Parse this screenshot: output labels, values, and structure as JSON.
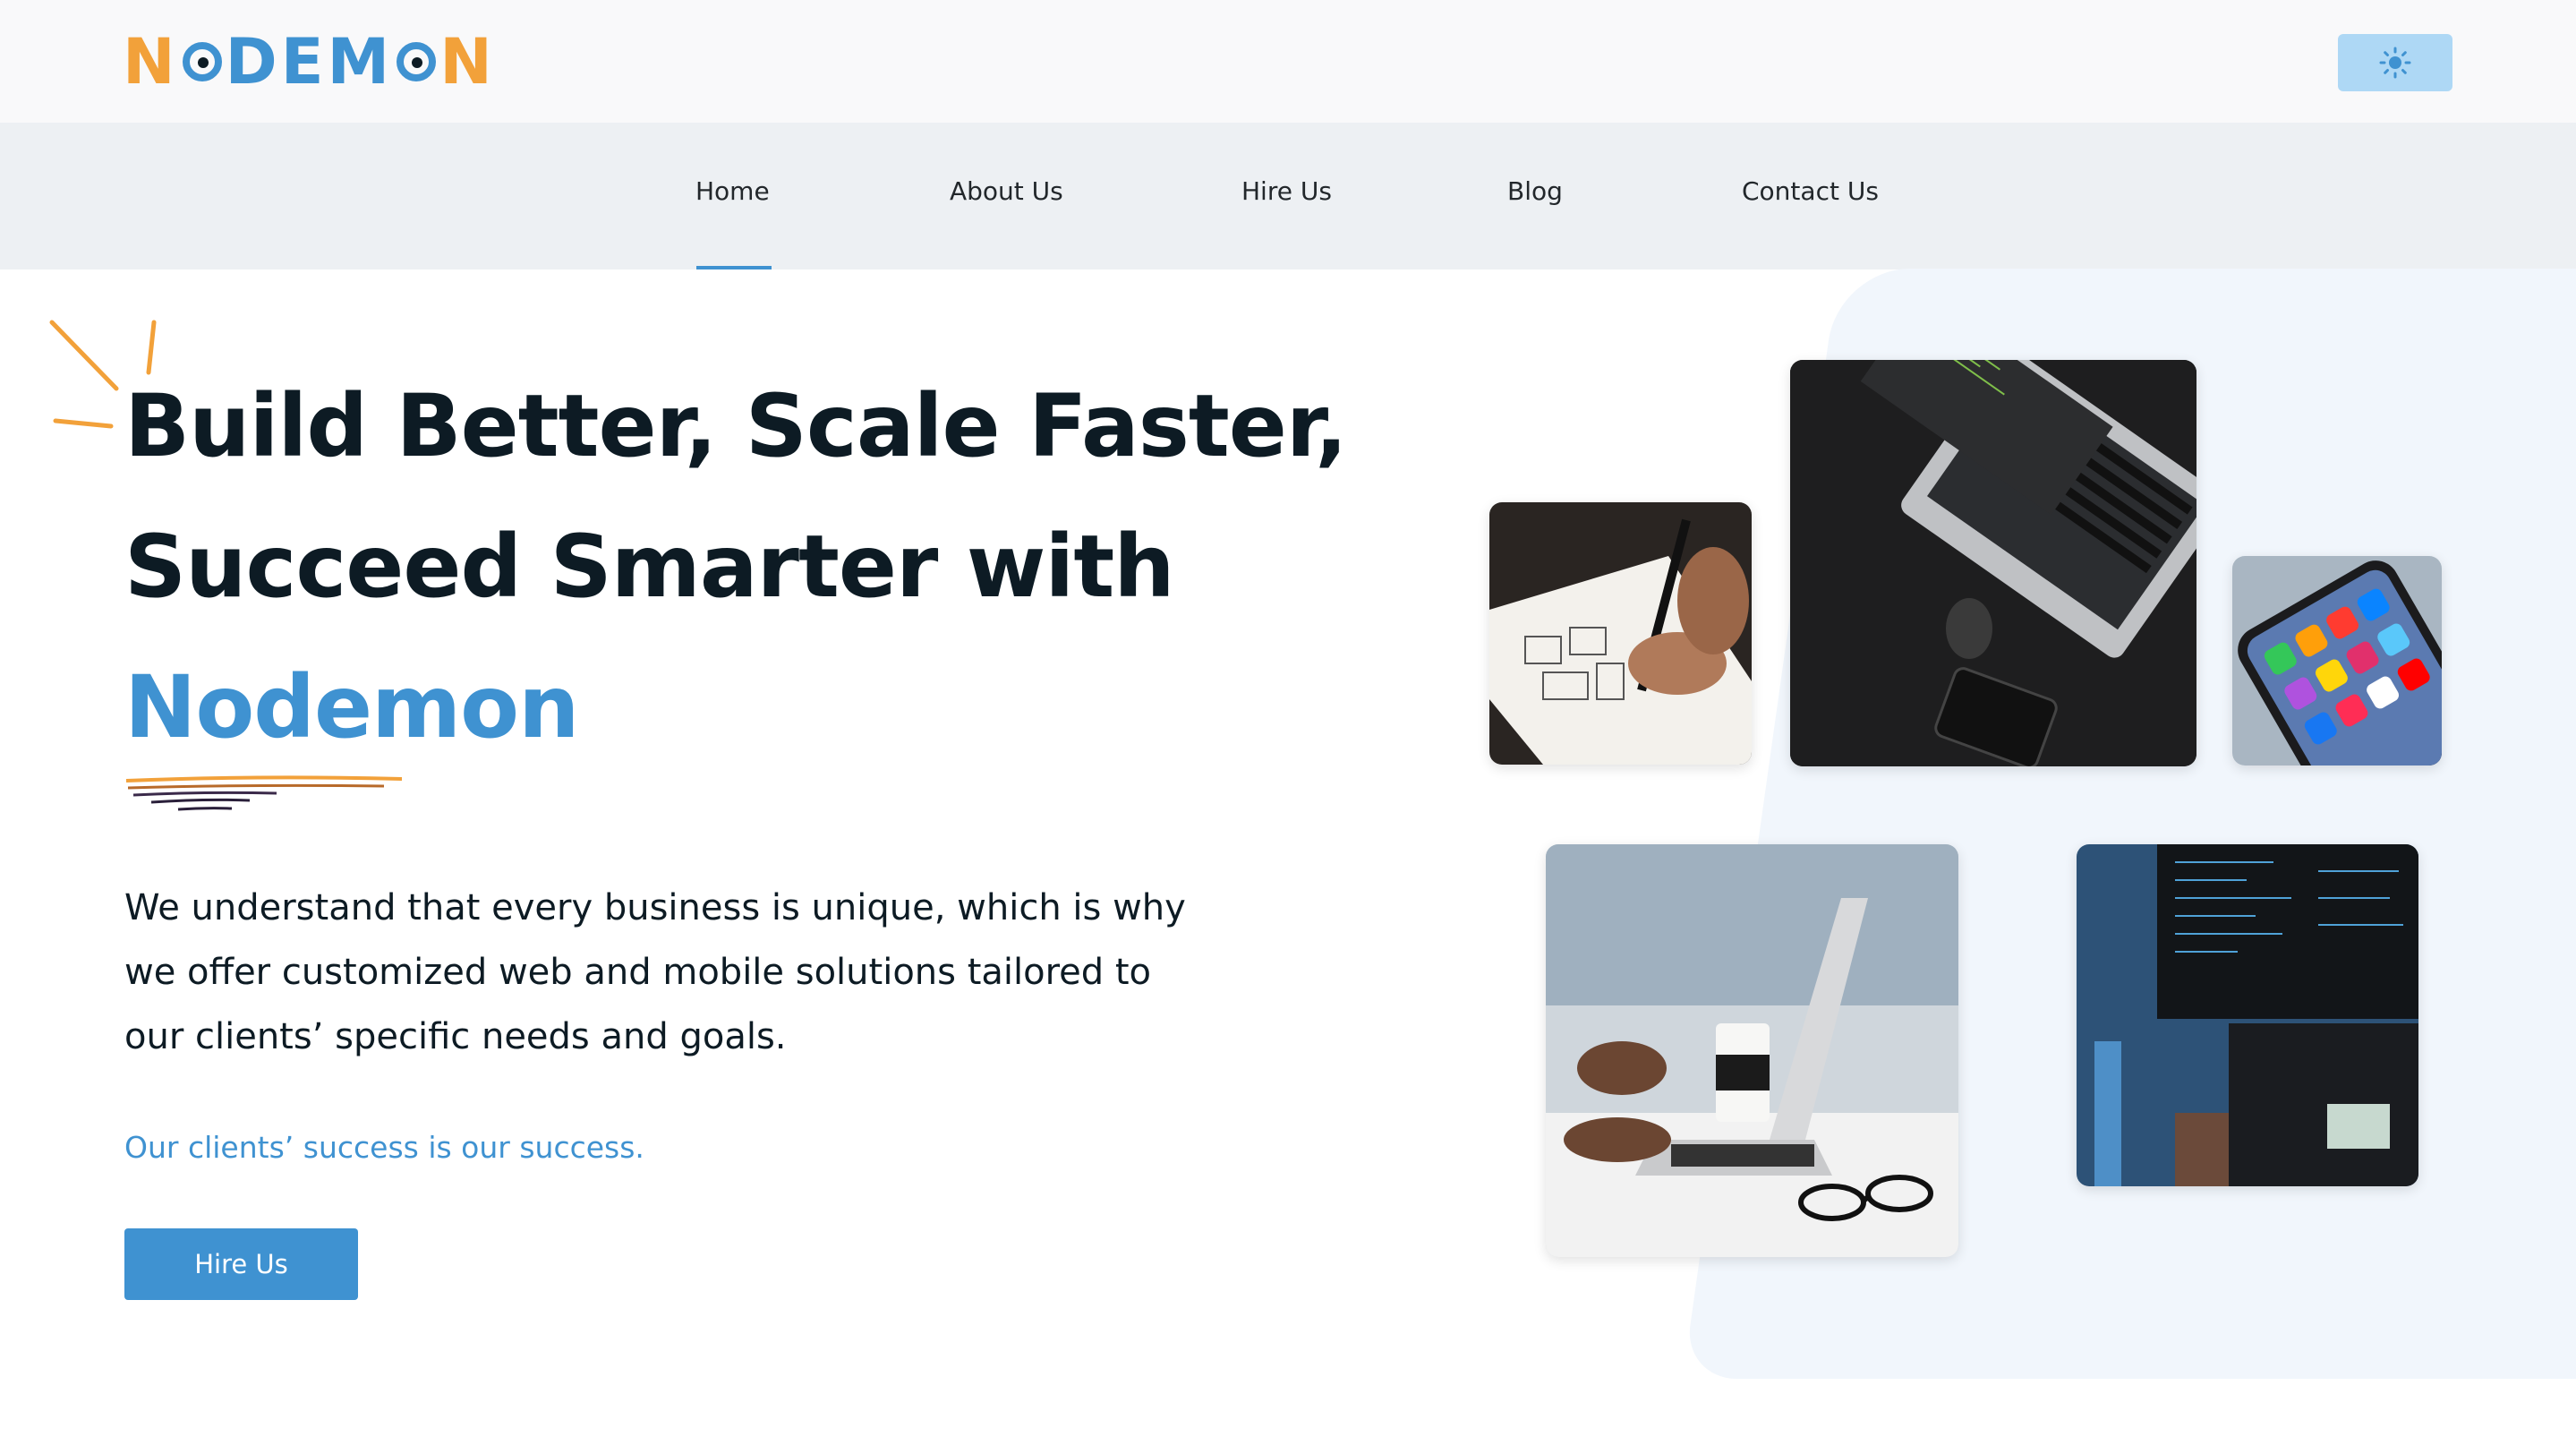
{
  "brand": {
    "name": "NODEMON",
    "colors": {
      "primary": "#3f92d1",
      "accent": "#f2a13a",
      "text": "#0d1b24"
    }
  },
  "header": {
    "theme_toggle": {
      "moon_icon": "moon-icon",
      "sun_icon": "sun-icon"
    }
  },
  "nav": {
    "items": [
      {
        "label": "Home",
        "active": true
      },
      {
        "label": "About Us"
      },
      {
        "label": "Hire Us"
      },
      {
        "label": "Blog"
      },
      {
        "label": "Contact Us"
      }
    ]
  },
  "hero": {
    "line1": "Build Better, Scale Faster,",
    "line2": "Succeed Smarter with",
    "line3": "Nodemon",
    "description": "We understand that every business is unique, which is why we offer customized web and mobile solutions tailored to our clients’ specific needs and goals.",
    "tagline": "Our clients’ success is our success.",
    "cta_label": "Hire Us"
  },
  "gallery": {
    "images": [
      {
        "name": "wireframe-sketch-photo"
      },
      {
        "name": "laptop-dark-desk-photo"
      },
      {
        "name": "smartphone-apps-photo"
      },
      {
        "name": "laptop-coffee-photo"
      },
      {
        "name": "code-monitors-photo"
      }
    ]
  }
}
